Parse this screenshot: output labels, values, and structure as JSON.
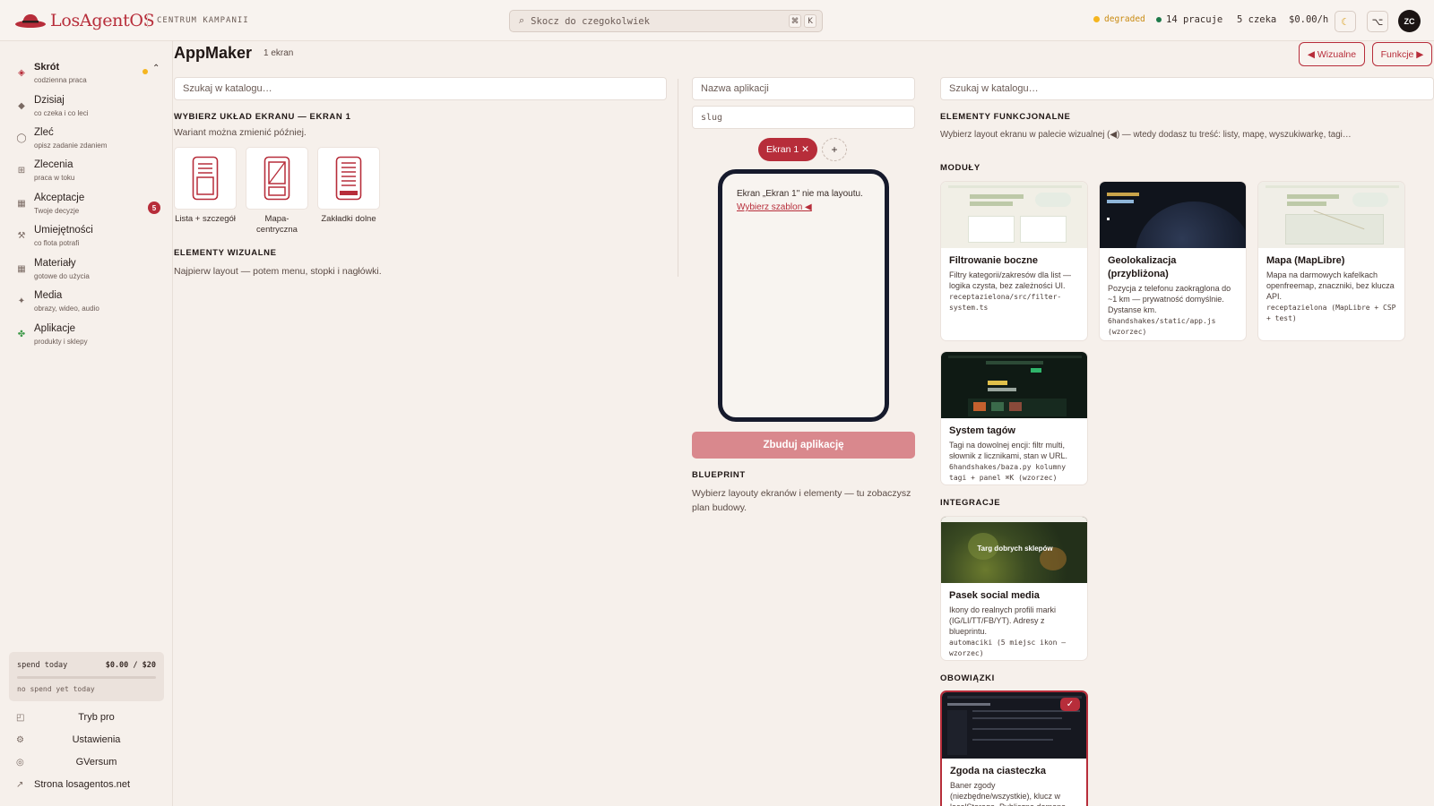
{
  "app": {
    "name": "LosAgentOS",
    "section": "CENTRUM KAMPANII"
  },
  "topbar": {
    "search_placeholder": "Skocz do czegokolwiek",
    "kbd1": "⌘",
    "kbd2": "K",
    "status_degraded": "degraded",
    "working": "14 pracuje",
    "waiting": "5 czeka",
    "cost": "$0.00/h",
    "avatar": "ZC",
    "colors": {
      "degraded": "#f5b51f",
      "working": "#1e7a4a"
    }
  },
  "sidebar": {
    "items": [
      {
        "label": "Skrót",
        "sub": "codzienna praca",
        "icon": "diamond-icon"
      },
      {
        "label": "Dzisiaj",
        "sub": "co czeka i co leci",
        "icon": "diamond-small-icon"
      },
      {
        "label": "Zleć",
        "sub": "opisz zadanie zdaniem",
        "icon": "circle-icon"
      },
      {
        "label": "Zlecenia",
        "sub": "praca w toku",
        "icon": "grid-icon"
      },
      {
        "label": "Akceptacje",
        "sub": "Twoje decyzje",
        "icon": "square-icon",
        "badge": "5"
      },
      {
        "label": "Umiejętności",
        "sub": "co flota potrafi",
        "icon": "tools-icon"
      },
      {
        "label": "Materiały",
        "sub": "gotowe do użycia",
        "icon": "square-icon"
      },
      {
        "label": "Media",
        "sub": "obrazy, wideo, audio",
        "icon": "sparkle-icon"
      },
      {
        "label": "Aplikacje",
        "sub": "produkty i sklepy",
        "icon": "clover-icon"
      }
    ],
    "spend": {
      "label": "spend today",
      "value": "$0.00 / $20",
      "note": "no spend yet today",
      "progress": 0
    },
    "footer": [
      {
        "label": "Tryb pro",
        "icon": "pro-icon"
      },
      {
        "label": "Ustawienia",
        "icon": "gear-icon"
      },
      {
        "label": "GVersum",
        "icon": "ring-icon"
      },
      {
        "label": "Strona losagentos.net",
        "icon": "external-link-icon"
      }
    ]
  },
  "main": {
    "title": "AppMaker",
    "screens_count": "1 ekran",
    "btn_visual": "◀ Wizualne",
    "btn_functions": "Funkcje ▶",
    "left": {
      "search_placeholder": "Szukaj w katalogu…",
      "layout_heading": "WYBIERZ UKŁAD EKRANU — EKRAN 1",
      "layout_hint": "Wariant można zmienić później.",
      "layouts": [
        "Lista + szczegół",
        "Mapa-centryczna",
        "Zakładki dolne"
      ],
      "visual_heading": "ELEMENTY WIZUALNE",
      "visual_hint": "Najpierw layout — potem menu, stopki i nagłówki."
    },
    "center": {
      "name_placeholder": "Nazwa aplikacji",
      "slug_placeholder": "slug",
      "screen_chip": "Ekran 1 ✕",
      "add_screen": "+",
      "phone_text": "Ekran „Ekran 1\" nie ma layoutu.",
      "phone_link": "Wybierz szablon ◀",
      "build_button": "Zbuduj aplikację",
      "blueprint_heading": "BLUEPRINT",
      "blueprint_hint": "Wybierz layouty ekranów i elementy — tu zobaczysz plan budowy."
    },
    "right": {
      "search_placeholder": "Szukaj w katalogu…",
      "functional_heading": "ELEMENTY FUNKCJONALNE",
      "functional_hint": "Wybierz layout ekranu w palecie wizualnej (◀) — wtedy dodasz tu treść: listy, mapę, wyszukiwarkę, tagi…",
      "modules_heading": "MODUŁY",
      "modules": [
        {
          "title": "Filtrowanie boczne",
          "desc": "Filtry kategorii/zakresów dla list — logika czysta, bez zależności UI.",
          "meta": "receptazielona/src/filter-system.ts",
          "thumb": "light"
        },
        {
          "title": "Geolokalizacja (przybliżona)",
          "desc": "Pozycja z telefonu zaokrąglona do ~1 km — prywatność domyślnie. Dystanse km.",
          "meta": "6handshakes/static/app.js (wzorzec)",
          "thumb": "dark-globe"
        },
        {
          "title": "Mapa (MapLibre)",
          "desc": "Mapa na darmowych kafelkach openfreemap, znaczniki, bez klucza API.",
          "meta": "receptazielona (MapLibre + CSP + test)",
          "thumb": "light-map"
        },
        {
          "title": "System tagów",
          "desc": "Tagi na dowolnej encji: filtr multi, słownik z licznikami, stan w URL.",
          "meta": "6handshakes/baza.py kolumny tagi + panel ⌘K (wzorzec)",
          "thumb": "dark-green"
        }
      ],
      "integrations_heading": "INTEGRACJE",
      "integrations": [
        {
          "title": "Pasek social media",
          "desc": "Ikony do realnych profili marki (IG/LI/TT/FB/YT). Adresy z blueprintu.",
          "meta": "automaciki (5 miejsc ikon — wzorzec)",
          "thumb": "market",
          "thumb_text": "Targ dobrych sklepów"
        }
      ],
      "duties_heading": "OBOWIĄZKI",
      "duties": [
        {
          "title": "Zgoda na ciasteczka",
          "desc": "Baner zgody (niezbędne/wszystkie), klucz w localStorage. Publiczna domena",
          "meta": "",
          "thumb": "dark-code",
          "selected": true
        }
      ]
    }
  }
}
